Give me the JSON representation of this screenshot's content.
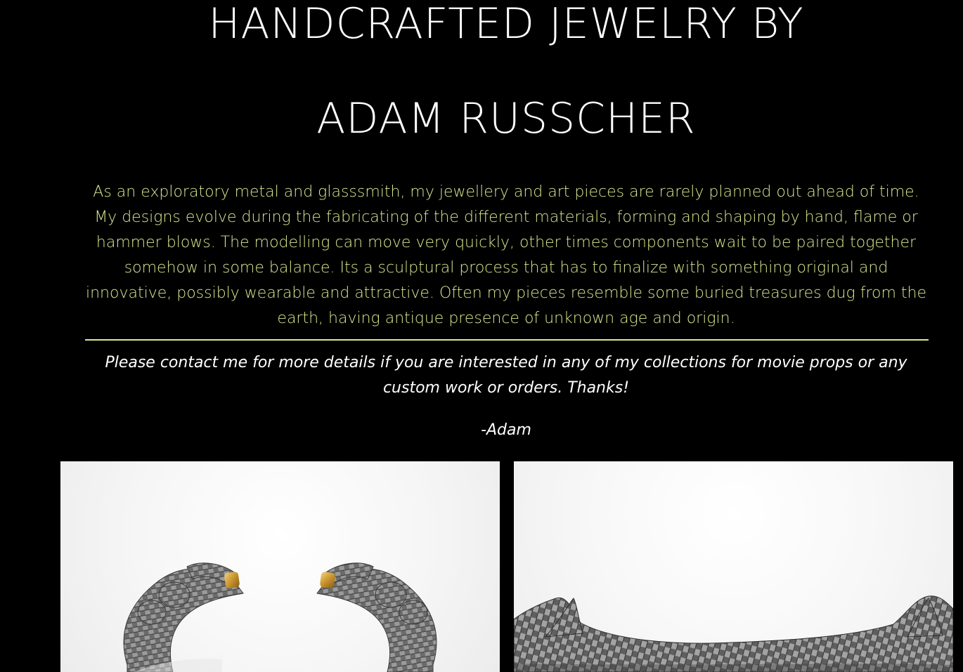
{
  "hero": {
    "title_line1": "HANDCRAFTED JEWELRY BY",
    "title_line2": "ADAM RUSSCHER"
  },
  "intro": {
    "text": "As an exploratory metal and glasssmith, my jewellery and art pieces are rarely planned out ahead of time. My designs evolve during the fabricating of the different materials, forming and shaping by hand, flame or hammer blows. The modelling can move very quickly, other times components wait to be paired together somehow in some balance. Its a sculptural process that has to finalize with something original and innovative, possibly wearable and attractive. Often my pieces resemble some buried treasures dug from the earth, having antique presence of unknown age and origin."
  },
  "contact": {
    "message": "Please contact me for more details if you are interested in any of my collections for movie props or any custom work or orders. Thanks!",
    "signature": "-Adam"
  },
  "colors": {
    "background": "#000000",
    "accent": "#d9e88f",
    "text": "#ffffff"
  },
  "gallery": {
    "items": [
      {
        "subject": "braided silver cuff bracelet with gold tips"
      },
      {
        "subject": "braided silver wire sculptural piece"
      }
    ]
  }
}
